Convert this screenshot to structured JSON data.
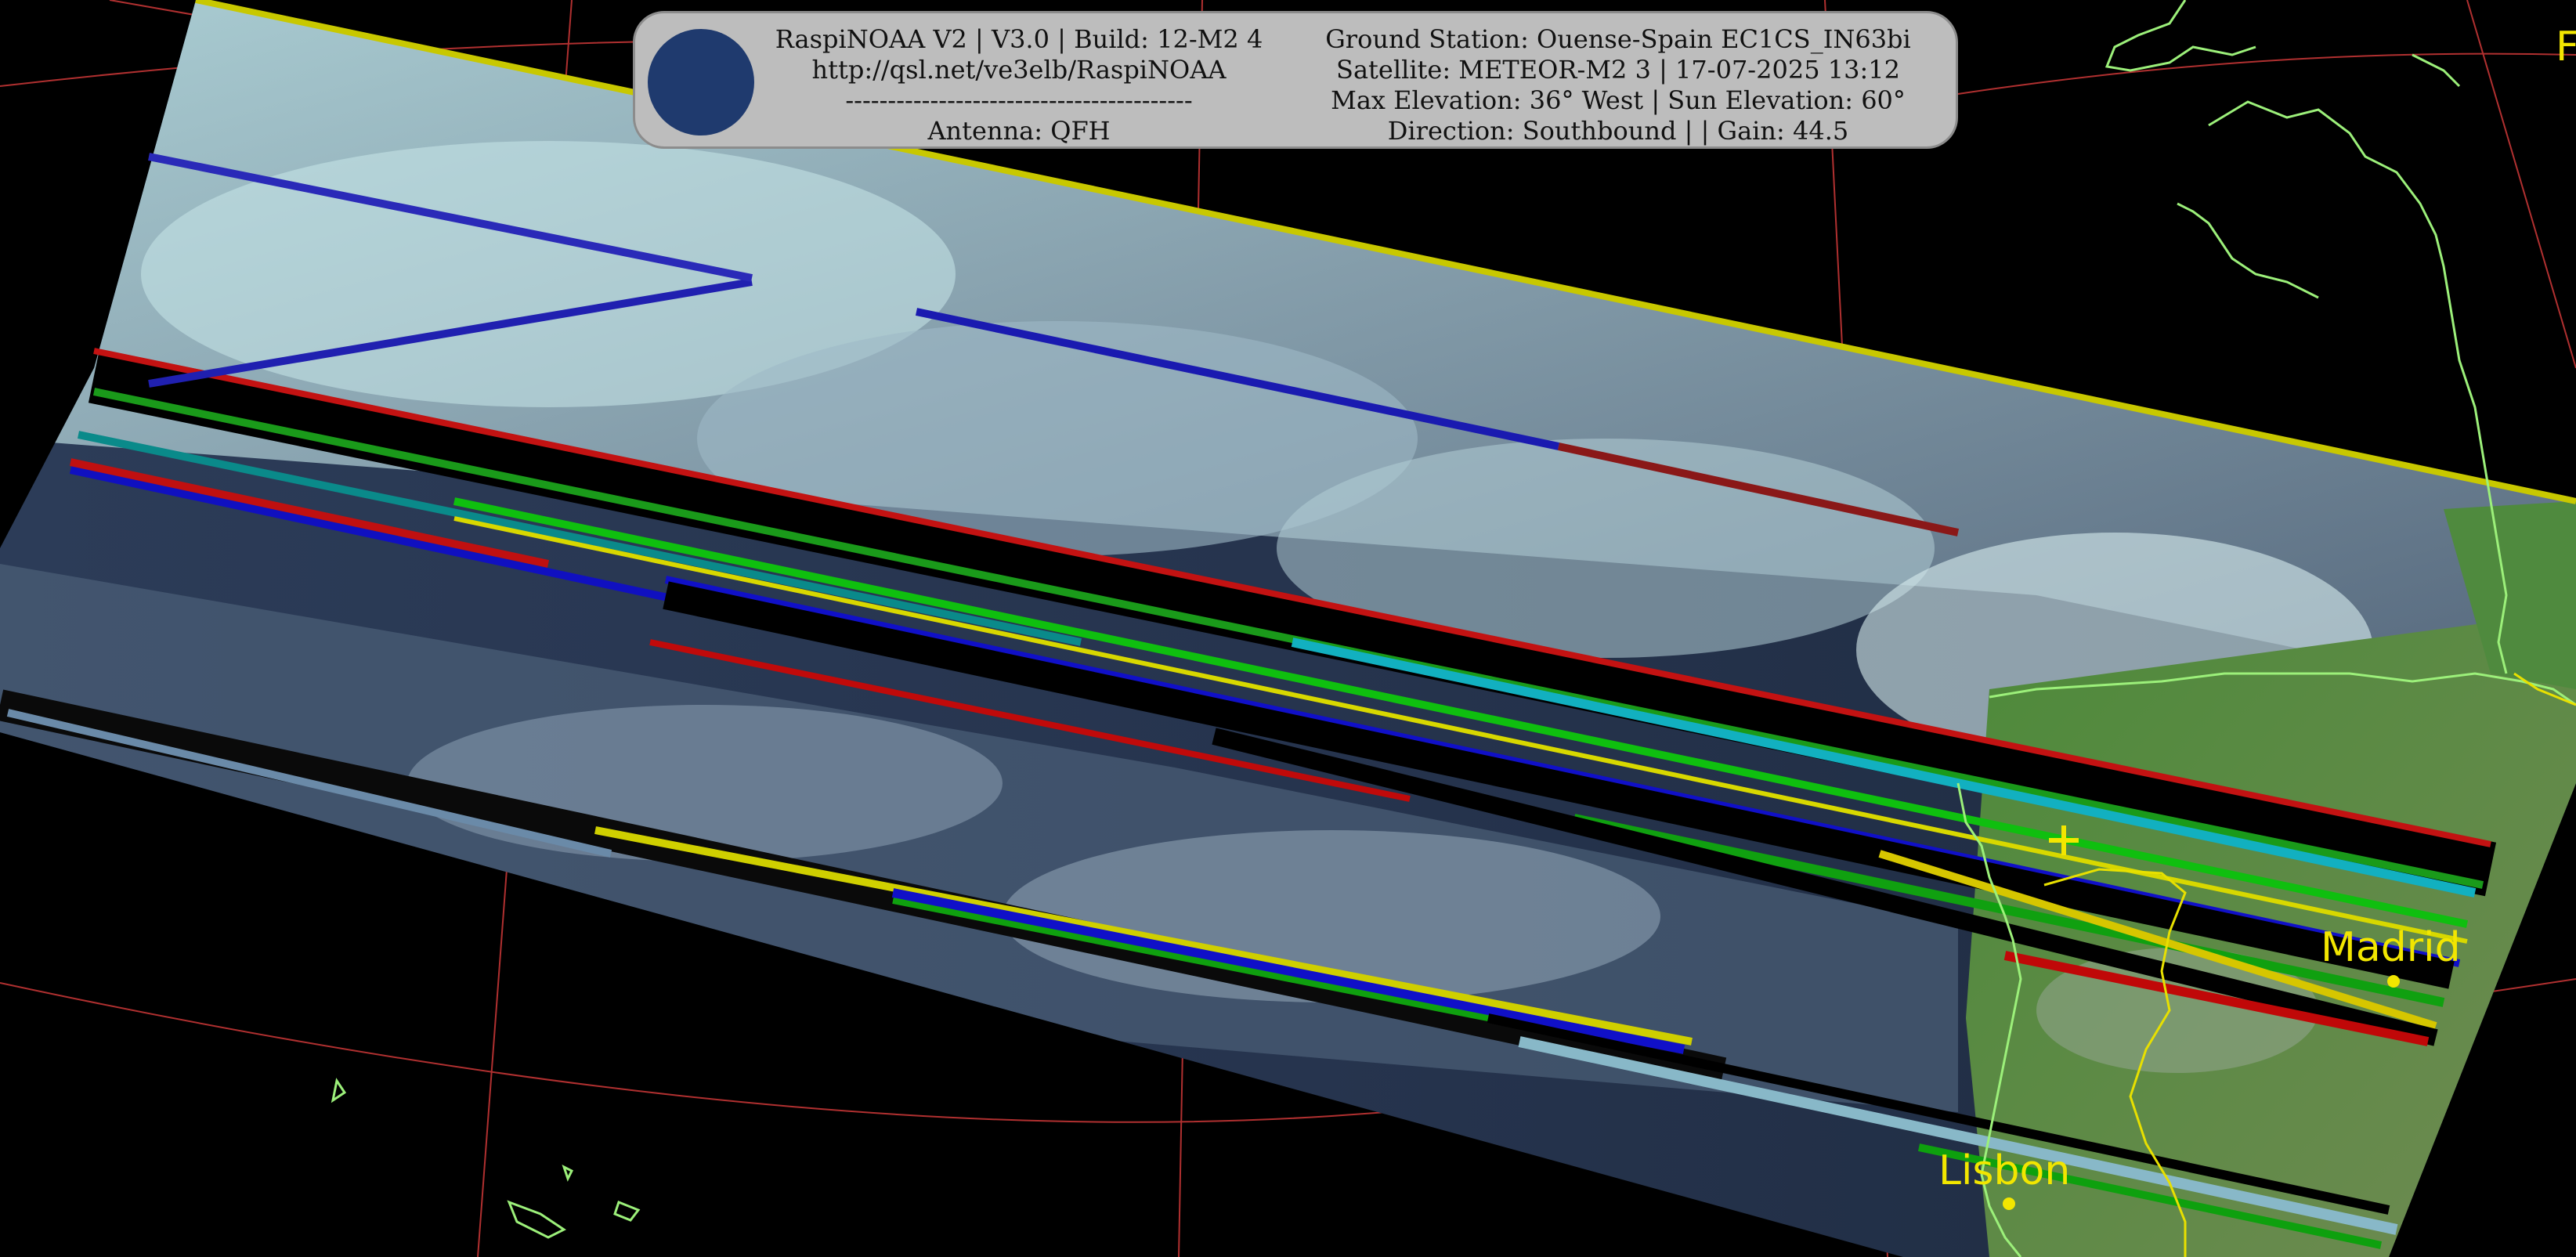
{
  "header": {
    "left_lines": [
      "RaspiNOAA V2 | V3.0 | Build: 12-M2 4",
      "http://qsl.net/ve3elb/RaspiNOAA",
      "-----------------------------------------",
      "Antenna: QFH"
    ],
    "right_lines": [
      "Ground Station: Ouense-Spain EC1CS_IN63bi",
      "Satellite: METEOR-M2 3 | 17-07-2025 13:12",
      "Max Elevation: 36° West | Sun Elevation: 60°",
      "Direction: Southbound | | Gain: 44.5"
    ]
  },
  "map_labels": {
    "madrid": "Madrid",
    "lisbon": "Lisbon",
    "edge_char": "F"
  },
  "icons": {
    "logo": "satellite-logo-icon",
    "station_marker": "plus-marker-icon",
    "city_marker": "city-dot-icon"
  },
  "colors": {
    "background": "#000000",
    "coastline": "#9cf07a",
    "border": "#e8e000",
    "graticule": "#b03030",
    "city_label": "#f2e600",
    "header_bg": "#bdbdbd"
  }
}
